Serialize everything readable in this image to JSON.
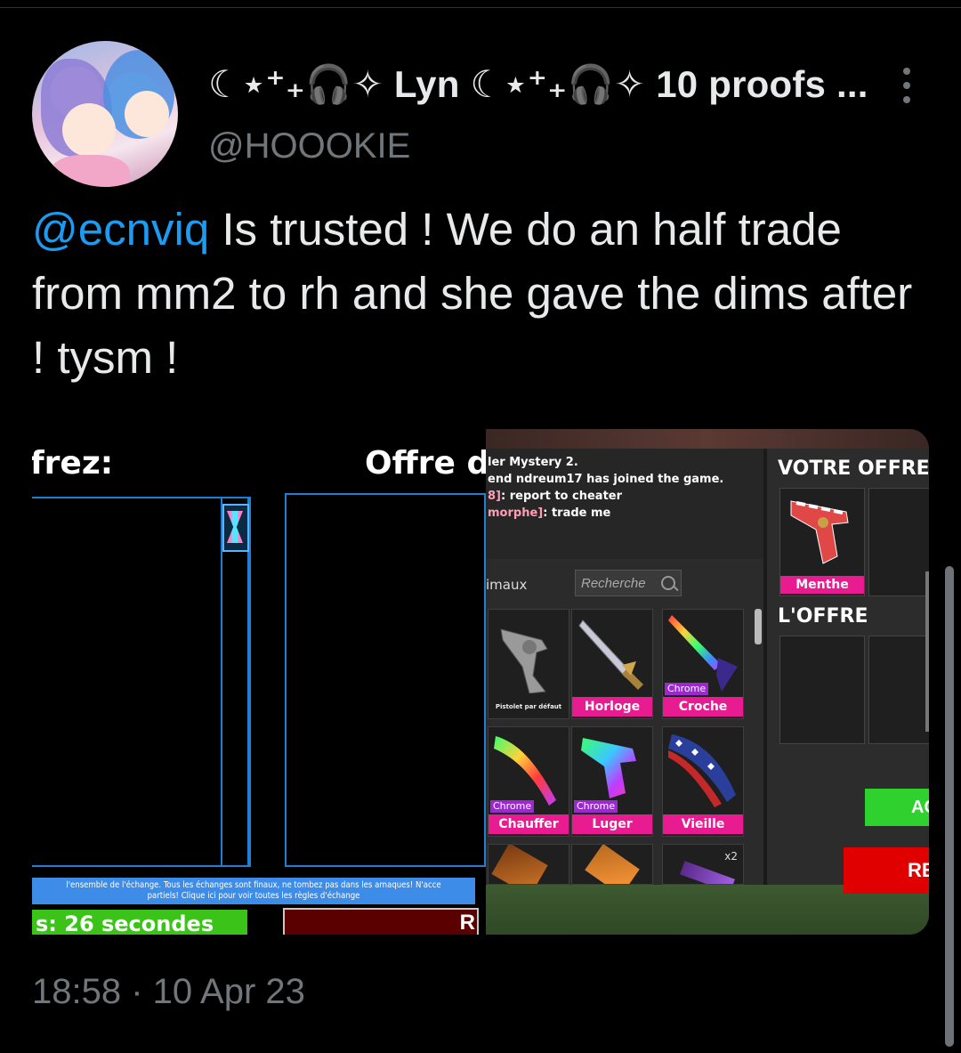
{
  "tweet": {
    "display_name": "☾⋆⁺₊🎧✧ Lyn ☾⋆⁺₊🎧✧ 10 proofs ...",
    "handle": "@HOOOKIE",
    "mention": "@ecnviq",
    "text": " Is trusted ! We do an half trade from mm2 to rh and she gave the dims after ! tysm !",
    "timestamp": "18:58 · 10 Apr 23"
  },
  "left_image": {
    "title_left": "frez:",
    "title_right": "Offre d",
    "notice_line1": "l'ensemble de l'échange. Tous les échanges sont finaux, ne tombez pas dans les arnaques! N'acce",
    "notice_line2": "partiels! Clique ici pour voir toutes les règles d'échange",
    "timer": "s: 26 secondes",
    "red_button": "R"
  },
  "right_image": {
    "chat": [
      {
        "text": "ler Mystery 2.",
        "pink": ""
      },
      {
        "text": "end ndreum17 has joined the game.",
        "pink": ""
      },
      {
        "text": ": report to cheater",
        "pink": "8]"
      },
      {
        "text": ": trade me",
        "pink": "morphe]"
      }
    ],
    "tab_label": "imaux",
    "search_placeholder": "Recherche",
    "items": [
      {
        "name": "Pistolet par défaut",
        "chrome": "",
        "plain": true
      },
      {
        "name": "Horloge",
        "chrome": "",
        "plain": false
      },
      {
        "name": "Croche",
        "chrome": "Chrome",
        "plain": false
      },
      {
        "name": "Chauffer",
        "chrome": "Chrome",
        "plain": false
      },
      {
        "name": "Luger",
        "chrome": "Chrome",
        "plain": false
      },
      {
        "name": "Vieille gloire",
        "chrome": "",
        "plain": false
      }
    ],
    "item_count": "x2",
    "your_offer_title": "VOTRE OFFRE",
    "your_offer_item": "Menthe",
    "their_offer_title": "L'OFFRE",
    "accept_label": "AC",
    "decline_label": "RE"
  },
  "colors": {
    "mention": "#1d9bf0",
    "item_label": "#e81b90",
    "chrome_tag": "#9c28d0",
    "accept": "#2ed12e",
    "decline": "#e00000"
  }
}
